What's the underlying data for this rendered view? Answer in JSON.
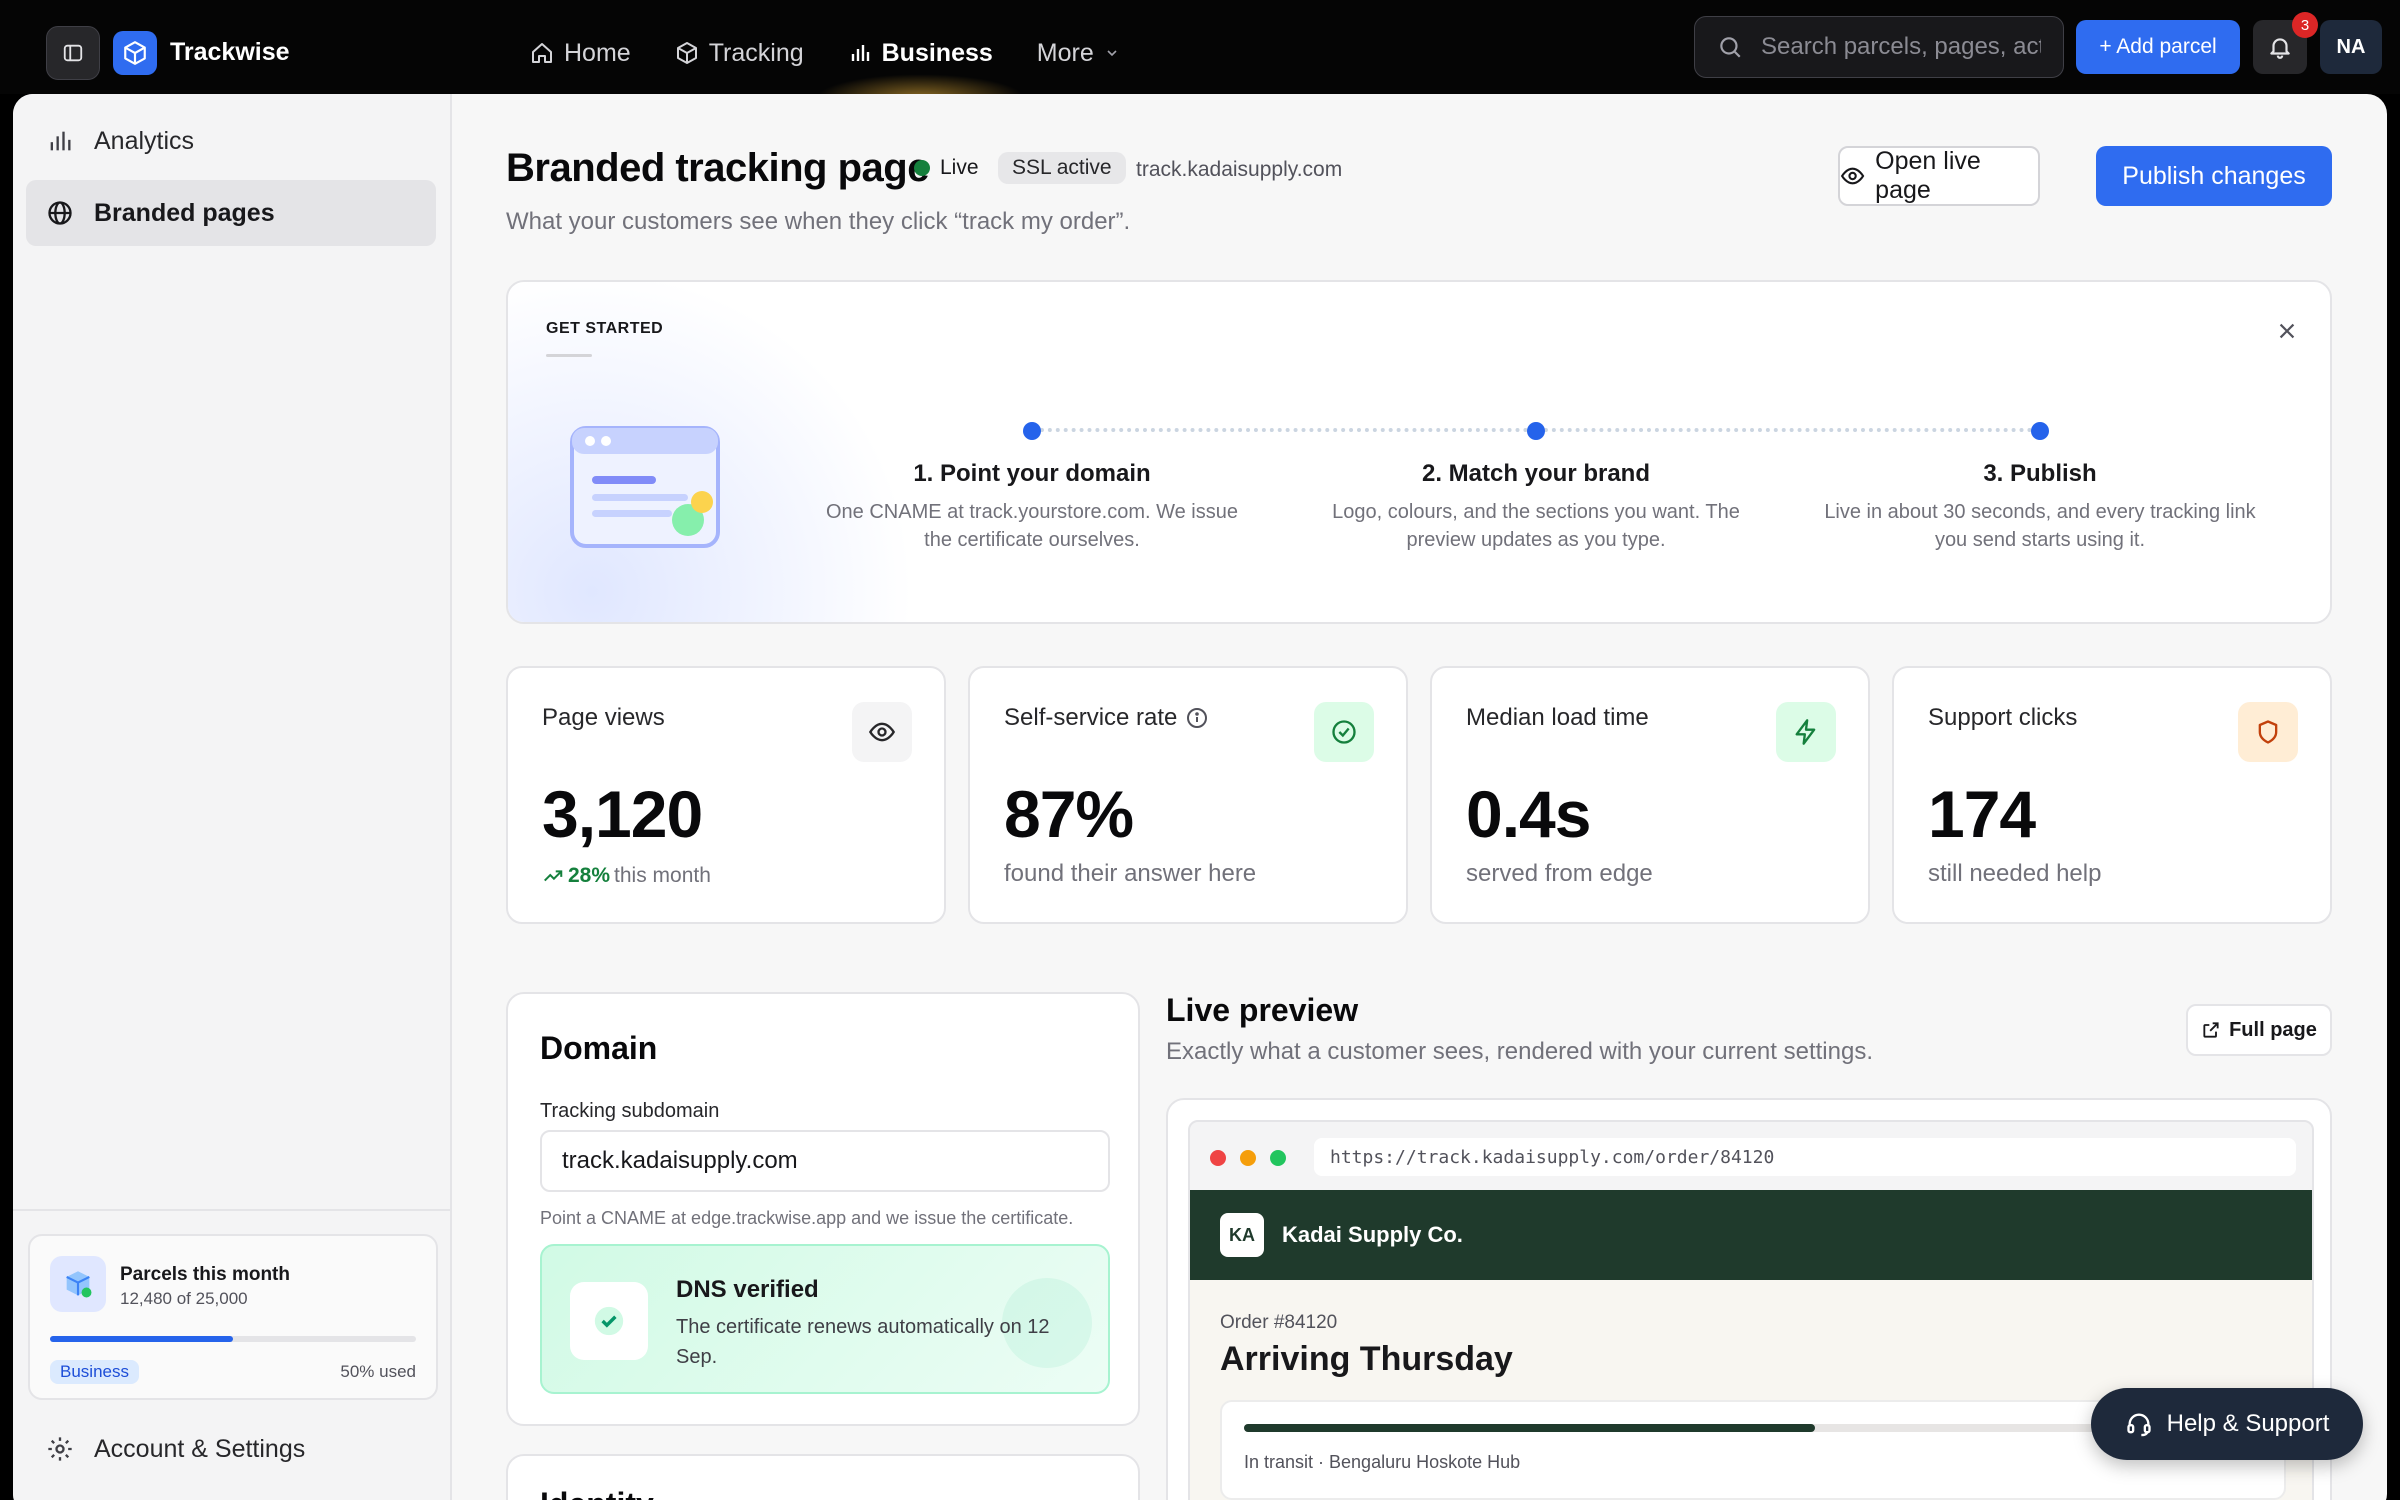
{
  "app": {
    "brand": "Trackwise",
    "nav": [
      {
        "label": "Home"
      },
      {
        "label": "Tracking"
      },
      {
        "label": "Business"
      },
      {
        "label": "More"
      }
    ],
    "search_placeholder": "Search parcels, pages, actions",
    "add_label": "+ Add parcel",
    "notification_count": "3",
    "avatar_initials": "NA",
    "accent_color": "#2f6cf0"
  },
  "sidebar": {
    "items": [
      {
        "label": "Analytics",
        "icon": "bar-chart-icon"
      },
      {
        "label": "Branded pages",
        "icon": "globe-icon",
        "active": true
      }
    ],
    "usage": {
      "title": "Parcels this month",
      "sub": "12,480 of 25,000",
      "used_fraction": 0.5,
      "plan": "Business",
      "pct_text": "50% used"
    },
    "account_label": "Account & Settings"
  },
  "header": {
    "title": "Branded tracking page",
    "status": "Live",
    "ssl": "SSL active",
    "domain": "track.kadaisupply.com",
    "subtitle": "What your customers see when they click “track my order”.",
    "open_live": "Open live page",
    "publish": "Publish changes"
  },
  "get_started": {
    "label": "GET STARTED",
    "steps": [
      {
        "title": "1. Point your domain",
        "body": "One CNAME at track.yourstore.com. We issue the certificate ourselves."
      },
      {
        "title": "2. Match your brand",
        "body": "Logo, colours, and the sections you want. The preview updates as you type."
      },
      {
        "title": "3. Publish",
        "body": "Live in about 30 seconds, and every tracking link you send starts using it."
      }
    ]
  },
  "stats": [
    {
      "label": "Page views",
      "value": "3,120",
      "trend": "28%",
      "trend_suffix": "this month",
      "icon": "eye-icon"
    },
    {
      "label": "Self-service rate",
      "value": "87%",
      "sub": "found their answer here",
      "icon": "check-circle-icon"
    },
    {
      "label": "Median load time",
      "value": "0.4s",
      "sub": "served from edge",
      "icon": "bolt-icon"
    },
    {
      "label": "Support clicks",
      "value": "174",
      "sub": "still needed help",
      "icon": "shield-icon"
    }
  ],
  "domain": {
    "title": "Domain",
    "field_label": "Tracking subdomain",
    "field_value": "track.kadaisupply.com",
    "hint": "Point a CNAME at edge.trackwise.app and we issue the certificate.",
    "dns_title": "DNS verified",
    "dns_body": "The certificate renews automatically on 12 Sep."
  },
  "identity": {
    "title": "Identity"
  },
  "preview": {
    "title": "Live preview",
    "subtitle": "Exactly what a customer sees, rendered with your current settings.",
    "full_page": "Full page",
    "url": "https://track.kadaisupply.com/order/84120",
    "store_initials": "KA",
    "store_name": "Kadai Supply Co.",
    "order_no": "Order #84120",
    "eta": "Arriving Thursday",
    "progress_fraction": 0.56,
    "status_line": "In transit · Bengaluru Hoskote Hub",
    "store_color": "#1f3a2c"
  },
  "help": {
    "label": "Help & Support"
  }
}
